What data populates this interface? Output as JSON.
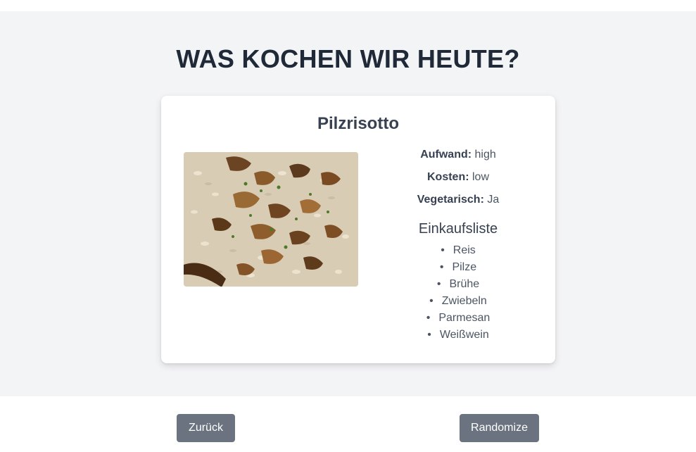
{
  "page": {
    "title": "WAS KOCHEN WIR HEUTE?"
  },
  "recipe": {
    "name": "Pilzrisotto",
    "image_alt": "Pilzrisotto",
    "effort_label": "Aufwand:",
    "effort_value": "high",
    "cost_label": "Kosten:",
    "cost_value": "low",
    "vegetarian_label": "Vegetarisch:",
    "vegetarian_value": "Ja",
    "shopping_title": "Einkaufsliste",
    "shopping_items": [
      "Reis",
      "Pilze",
      "Brühe",
      "Zwiebeln",
      "Parmesan",
      "Weißwein"
    ]
  },
  "buttons": {
    "back_label": "Zurück",
    "randomize_label": "Randomize"
  },
  "colors": {
    "background": "#f3f4f6",
    "card": "#ffffff",
    "title": "#1f2937",
    "button": "#6b7280"
  }
}
